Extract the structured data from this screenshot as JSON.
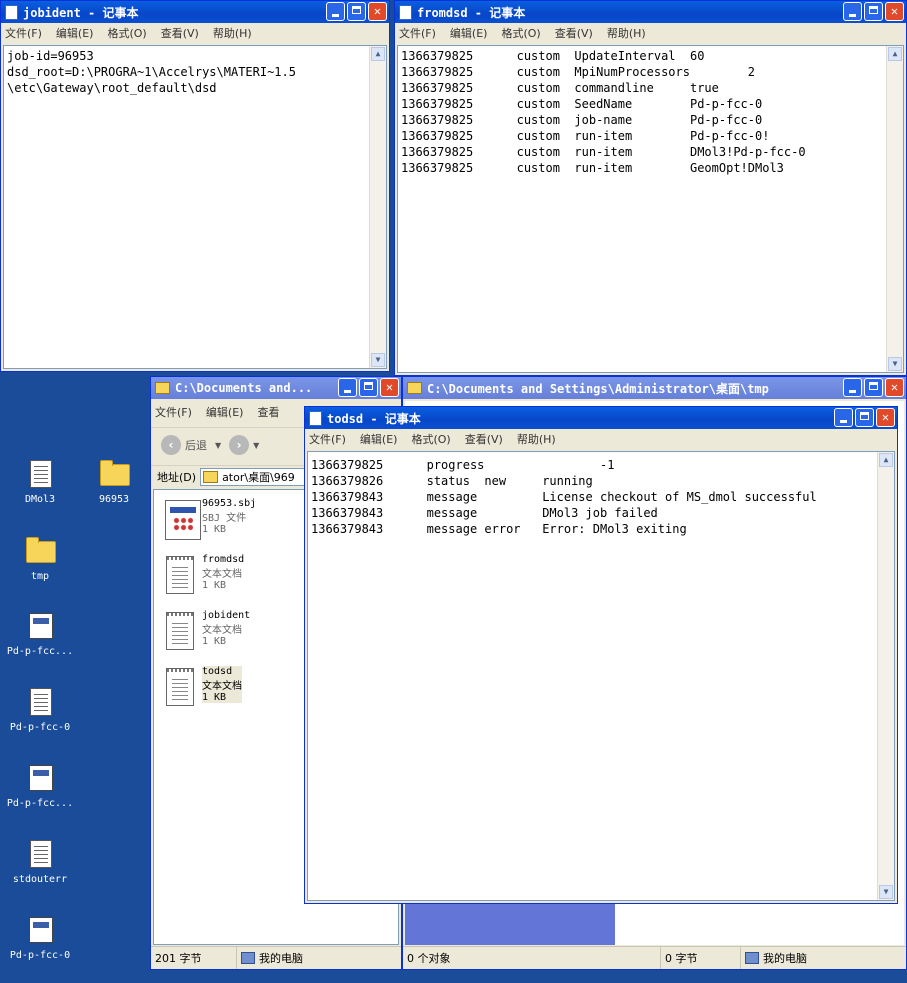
{
  "desktop": {
    "icons": [
      {
        "label": "DMol3",
        "kind": "doc"
      },
      {
        "label": "96953",
        "kind": "folder"
      },
      {
        "label": "tmp",
        "kind": "folder"
      },
      {
        "label": "Pd-p-fcc...",
        "kind": "app"
      },
      {
        "label": "Pd-p-fcc-0",
        "kind": "doc"
      },
      {
        "label": "Pd-p-fcc...",
        "kind": "app"
      },
      {
        "label": "stdouterr",
        "kind": "doc"
      },
      {
        "label": "Pd-p-fcc-0",
        "kind": "multi"
      }
    ]
  },
  "menu": {
    "file": "文件(F)",
    "edit": "编辑(E)",
    "format": "格式(O)",
    "view": "查看(V)",
    "help": "帮助(H)"
  },
  "jobident": {
    "title": "jobident - 记事本",
    "lines": [
      "job-id=96953",
      "dsd_root=D:\\PROGRA~1\\Accelrys\\MATERI~1.5",
      "\\etc\\Gateway\\root_default\\dsd"
    ]
  },
  "fromdsd": {
    "title": "fromdsd - 记事本",
    "lines": [
      "1366379825      custom  UpdateInterval  60",
      "1366379825      custom  MpiNumProcessors        2",
      "1366379825      custom  commandline     true",
      "1366379825      custom  SeedName        Pd-p-fcc-0",
      "1366379825      custom  job-name        Pd-p-fcc-0",
      "1366379825      custom  run-item        Pd-p-fcc-0!",
      "1366379825      custom  run-item        DMol3!Pd-p-fcc-0",
      "1366379825      custom  run-item        GeomOpt!DMol3"
    ]
  },
  "explorer_left": {
    "title": "C:\\Documents and...",
    "menu": {
      "file": "文件(F)",
      "edit": "编辑(E)",
      "view": "查看"
    },
    "back_label": "后退",
    "address_label": "地址(D)",
    "address_value": "ator\\桌面\\969",
    "files": [
      {
        "name": "96953.sbj",
        "type": "SBJ 文件",
        "size": "1 KB",
        "kind": "sbj"
      },
      {
        "name": "fromdsd",
        "type": "文本文档",
        "size": "1 KB",
        "kind": "note"
      },
      {
        "name": "jobident",
        "type": "文本文档",
        "size": "1 KB",
        "kind": "note"
      },
      {
        "name": "todsd",
        "type": "文本文档",
        "size": "1 KB",
        "kind": "note"
      }
    ],
    "status_size": "201 字节",
    "status_location": "我的电脑"
  },
  "explorer_right": {
    "title": "C:\\Documents and Settings\\Administrator\\桌面\\tmp",
    "status_objects": "0 个对象",
    "status_size": "0 字节",
    "status_location": "我的电脑"
  },
  "todsd": {
    "title": "todsd - 记事本",
    "lines": [
      "1366379825      progress                -1",
      "1366379826      status  new     running",
      "1366379843      message         License checkout of MS_dmol successful",
      "1366379843      message         DMol3 job failed",
      "1366379843      message error   Error: DMol3 exiting"
    ]
  }
}
